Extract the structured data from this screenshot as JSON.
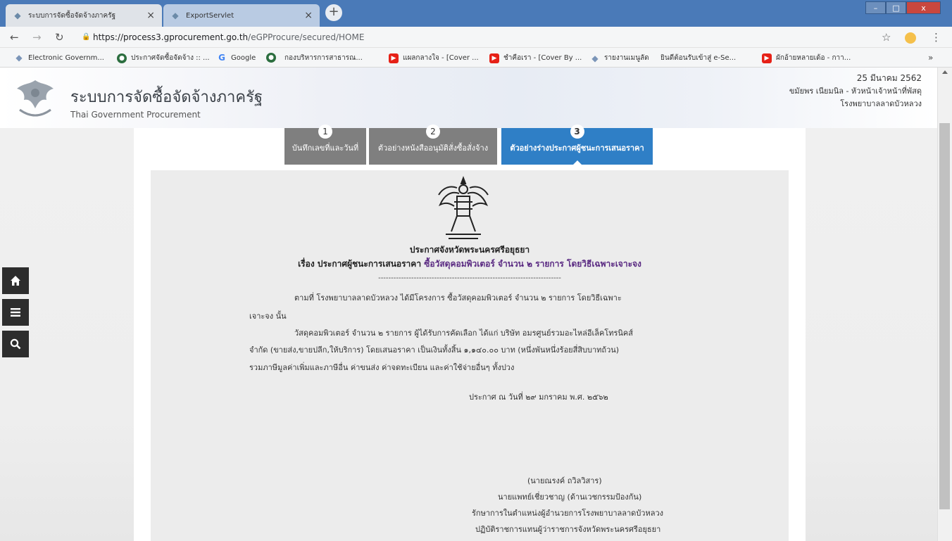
{
  "browser": {
    "tabs": [
      {
        "title": "ระบบการจัดซื้อจัดจ้างภาครัฐ",
        "active": true
      },
      {
        "title": "ExportServlet",
        "active": false
      }
    ],
    "url_host": "https://process3.gprocurement.go.th",
    "url_path": "/eGPProcure/secured/HOME",
    "bookmarks": [
      {
        "label": "Electronic Governm...",
        "icon": "egp-icon"
      },
      {
        "label": "ประกาศจัดซื้อจัดจ้าง :: ...",
        "icon": "gov-seal-icon"
      },
      {
        "label": "Google",
        "icon": "google-icon"
      },
      {
        "label": "",
        "icon": "gov-seal-icon"
      },
      {
        "label": "กองบริหารการสาธารณ...",
        "icon": "document-icon"
      },
      {
        "label": "แผลกลางใจ - [Cover ...",
        "icon": "youtube-icon"
      },
      {
        "label": "ชำคือเรา - [Cover By ...",
        "icon": "youtube-icon"
      },
      {
        "label": "รายงานเมนูลัด",
        "icon": "egp-icon"
      },
      {
        "label": "ยินดีต้อนรับเข้าสู่ e-Se...",
        "icon": "document-icon"
      },
      {
        "label": "ผักอ้ายหลายเด้อ - กาา...",
        "icon": "youtube-icon"
      }
    ],
    "more": "»"
  },
  "header": {
    "title": "ระบบการจัดซื้อจัดจ้างภาครัฐ",
    "subtitle": "Thai Government Procurement",
    "date": "25 มีนาคม 2562",
    "user": "ขมัยพร เนียมนิล - หัวหน้าเจ้าหน้าที่พัสดุ",
    "org": "โรงพยาบาลลาดบัวหลวง"
  },
  "steps": [
    {
      "num": "1",
      "label": "บันทึกเลขที่และวันที่"
    },
    {
      "num": "2",
      "label": "ตัวอย่างหนังสืออนุมัติสั่งซื้อสั่งจ้าง"
    },
    {
      "num": "3",
      "label": "ตัวอย่างร่างประกาศผู้ชนะการเสนอราคา"
    }
  ],
  "document": {
    "title": "ประกาศจังหวัดพระนครศรีอยุธยา",
    "subject_prefix": "เรื่อง ประกาศผู้ชนะการเสนอราคา",
    "subject_highlight": "ซื้อวัสดุคอมพิวเตอร์ จำนวน ๒ รายการ โดยวิธีเฉพาะเจาะจง",
    "separator": "------------------------------------------------------------------------",
    "para1_line1": "ตามที่ โรงพยาบาลลาดบัวหลวง ได้มีโครงการ ซื้อวัสดุคอมพิวเตอร์ จำนวน ๒ รายการ โดยวิธีเฉพาะ",
    "para1_line2": "เจาะจง  นั้น",
    "para2_line1": "วัสดุคอมพิวเตอร์ จำนวน ๒ รายการ ผู้ได้รับการคัดเลือก ได้แก่ บริษัท อมรศูนย์รวมอะไหล่อีเล็คโทรนิคส์",
    "para2_line2": "จำกัด (ขายส่ง,ขายปลีก,ให้บริการ) โดยเสนอราคา เป็นเงินทั้งสิ้น ๑,๑๔๐.๐๐ บาท (หนึ่งพันหนึ่งร้อยสี่สิบบาทถ้วน)",
    "para2_line3": "รวมภาษีมูลค่าเพิ่มและภาษีอื่น ค่าขนส่ง ค่าจดทะเบียน และค่าใช้จ่ายอื่นๆ ทั้งปวง",
    "announce_date": "ประกาศ ณ วันที่  ๒๙ มกราคม พ.ศ. ๒๕๖๒",
    "signer_name": "(นายณรงค์     ถวิลวิสาร)",
    "signer_pos1": "นายแพทย์เชี่ยวชาญ (ด้านเวชกรรมป้องกัน)",
    "signer_pos2": "รักษาการในตำแหน่งผู้อำนวยการโรงพยาบาลลาดบัวหลวง",
    "signer_pos3": "ปฏิบัติราชการแทนผู้ว่าราชการจังหวัดพระนครศรีอยุธยา"
  },
  "colors": {
    "step_active": "#2f7fc6",
    "step_inactive": "#7f7f7f",
    "subject_highlight": "#5a2a82",
    "side_nav": "#2d2d2d"
  },
  "side_nav": [
    {
      "icon": "home-icon"
    },
    {
      "icon": "menu-icon"
    },
    {
      "icon": "search-icon"
    }
  ]
}
